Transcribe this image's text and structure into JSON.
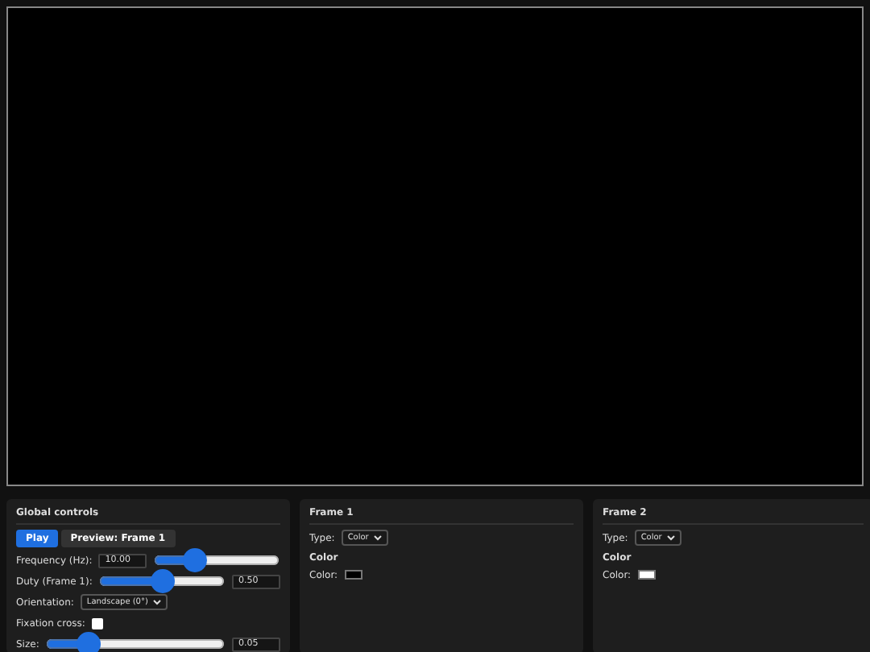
{
  "stage": {
    "kind": "canvas"
  },
  "global_controls": {
    "title": "Global controls",
    "buttons": [
      {
        "label": "Play",
        "selected": true
      },
      {
        "label": "Preview: Frame 1",
        "selected": false
      }
    ],
    "rows": [
      {
        "kind": "slider-field",
        "label": "Frequency (Hz):",
        "value": "10.00",
        "level": 0.29,
        "field_first": true
      },
      {
        "kind": "slider-field",
        "label": "Duty (Frame 1):",
        "value": "0.50",
        "level": 0.5,
        "field_first": false
      },
      {
        "kind": "select",
        "label": "Orientation:",
        "value": "Landscape (0°)"
      },
      {
        "kind": "checkbox",
        "label": "Fixation cross:",
        "checked": false
      },
      {
        "kind": "slider-field",
        "label": "Size:",
        "value": "0.05",
        "level": 0.2,
        "field_first": false
      }
    ]
  },
  "frames": [
    {
      "title": "Frame 1",
      "type_label": "Type:",
      "type_value": "Color",
      "section": "Color",
      "color_label": "Color:",
      "color": "#000000"
    },
    {
      "title": "Frame 2",
      "type_label": "Type:",
      "type_value": "Color",
      "section": "Color",
      "color_label": "Color:",
      "color": "#ffffff"
    }
  ]
}
